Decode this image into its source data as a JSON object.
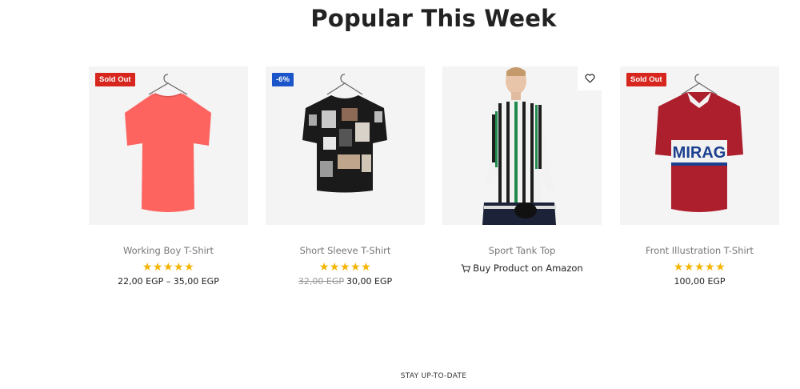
{
  "section": {
    "title": "Popular This Week"
  },
  "products": [
    {
      "title": "Working Boy T-Shirt",
      "badge": "Sold Out",
      "rating": 5,
      "stars": "★★★★★",
      "price": "22,00 EGP – 35,00 EGP"
    },
    {
      "title": "Short Sleeve T-Shirt",
      "badge": "-6%",
      "rating": 5,
      "stars": "★★★★★",
      "old_price": "32,00 EGP",
      "price": "30,00 EGP"
    },
    {
      "title": "Sport Tank Top",
      "buy_label": "Buy Product on Amazon"
    },
    {
      "title": "Front Illustration T-Shirt",
      "badge": "Sold Out",
      "rating": 5,
      "stars": "★★★★★",
      "price": "100,00 EGP"
    }
  ],
  "colors": {
    "sold_badge": "#d7261e",
    "sale_badge": "#1b55c9",
    "star": "#f4b400"
  },
  "icons": [
    "heart-icon",
    "cart-icon",
    "star-icon"
  ],
  "newsletter": {
    "label": "STAY UP-TO-DATE"
  }
}
